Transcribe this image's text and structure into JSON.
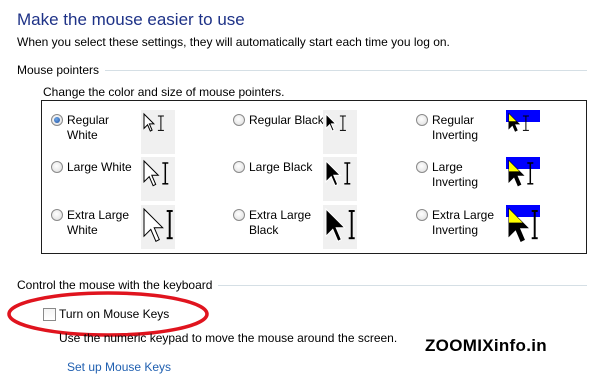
{
  "page": {
    "title": "Make the mouse easier to use",
    "subtitle": "When you select these settings, they will automatically start each time you log on."
  },
  "mouse_pointers": {
    "heading": "Mouse pointers",
    "description": "Change the color and size of mouse pointers.",
    "options": [
      {
        "label": "Regular\nWhite",
        "checked": true,
        "scheme": "white",
        "size": "regular"
      },
      {
        "label": "Regular Black",
        "checked": false,
        "scheme": "black",
        "size": "regular"
      },
      {
        "label": "Regular\nInverting",
        "checked": false,
        "scheme": "inverting",
        "size": "regular"
      },
      {
        "label": "Large White",
        "checked": false,
        "scheme": "white",
        "size": "large"
      },
      {
        "label": "Large Black",
        "checked": false,
        "scheme": "black",
        "size": "large"
      },
      {
        "label": "Large\nInverting",
        "checked": false,
        "scheme": "inverting",
        "size": "large"
      },
      {
        "label": "Extra Large\nWhite",
        "checked": false,
        "scheme": "white",
        "size": "extra-large"
      },
      {
        "label": "Extra Large\nBlack",
        "checked": false,
        "scheme": "black",
        "size": "extra-large"
      },
      {
        "label": "Extra Large\nInverting",
        "checked": false,
        "scheme": "inverting",
        "size": "extra-large"
      }
    ]
  },
  "keyboard": {
    "heading": "Control the mouse with the keyboard",
    "mouse_keys_label": "Turn on Mouse Keys",
    "mouse_keys_checked": false,
    "mouse_keys_desc": "Use the numeric keypad to move the mouse around the screen.",
    "setup_link": "Set up Mouse Keys"
  },
  "watermark": "ZOOMIXinfo.in",
  "colors": {
    "title": "#1e3287",
    "link": "#1f5fb0",
    "highlight_ellipse": "#e0141e",
    "inverting_blue": "#0000ff",
    "inverting_yellow": "#ffff00"
  }
}
